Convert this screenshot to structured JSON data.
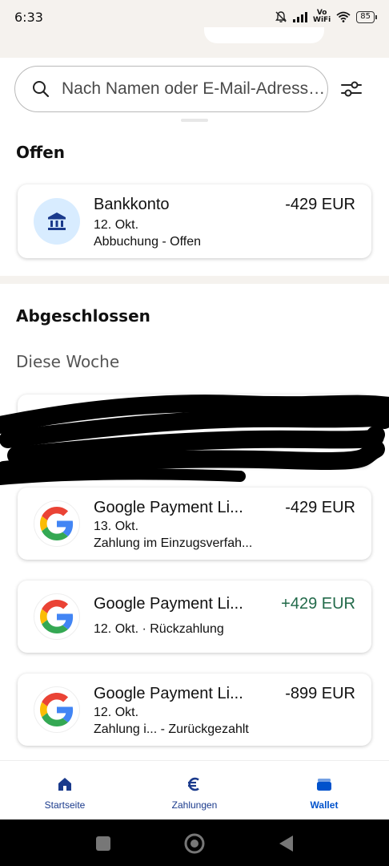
{
  "status_bar": {
    "time": "6:33",
    "vowifi_top": "Vo",
    "vowifi_bottom": "WiFi",
    "battery": "85"
  },
  "search": {
    "placeholder": "Nach Namen oder E-Mail-Adresse suchen"
  },
  "sections": {
    "open_title": "Offen",
    "closed_title": "Abgeschlossen",
    "this_week_label": "Diese Woche"
  },
  "open_transactions": [
    {
      "name": "Bankkonto",
      "amount": "-429 EUR",
      "date": "12. Okt.",
      "detail": "Abbuchung - Offen",
      "icon": "bank-icon"
    }
  ],
  "closed_transactions": [
    {
      "name": "Google Payment Li...",
      "amount": "-429 EUR",
      "date": "13. Okt.",
      "detail": "Zahlung im Einzugsverfah...",
      "icon": "google-icon"
    },
    {
      "name": "Google Payment Li...",
      "amount": "+429 EUR",
      "date_detail": "12. Okt. · Rückzahlung",
      "icon": "google-icon"
    },
    {
      "name": "Google Payment Li...",
      "amount": "-899 EUR",
      "date": "12. Okt.",
      "detail": "Zahlung i... - Zurückgezahlt",
      "icon": "google-icon"
    }
  ],
  "bottom_nav": [
    {
      "label": "Startseite",
      "icon": "home-icon",
      "active": false
    },
    {
      "label": "Zahlungen",
      "icon": "euro-icon",
      "active": false
    },
    {
      "label": "Wallet",
      "icon": "wallet-icon",
      "active": true
    }
  ],
  "colors": {
    "positive_amount": "#226a4a",
    "nav_active": "#0052cc",
    "nav_inactive": "#1a3a8c",
    "bank_icon_bg": "#d8ecff"
  }
}
